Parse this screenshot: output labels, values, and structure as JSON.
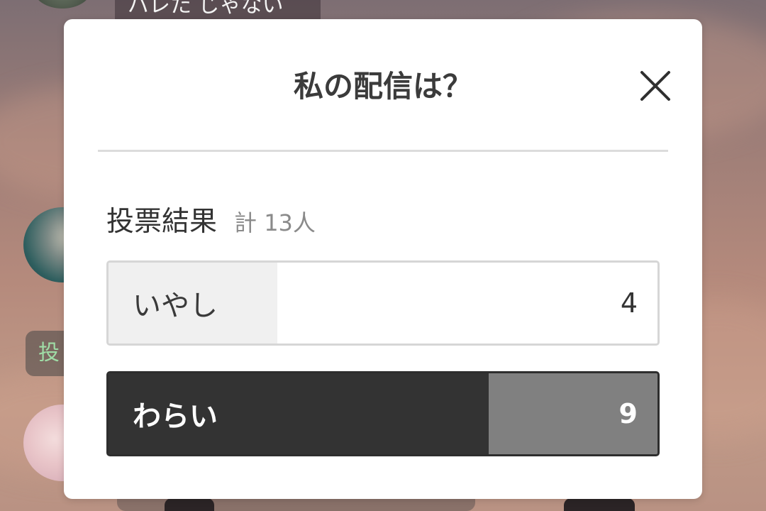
{
  "background": {
    "chat_snippet": "バレた じゃない",
    "poll_chip_text": "投"
  },
  "modal": {
    "title": "私の配信は？",
    "close_icon": "close-icon",
    "result_label": "投票結果",
    "result_total": "計 13人",
    "options": [
      {
        "label": "いやし",
        "count": "4",
        "share": 0.307,
        "selected": false
      },
      {
        "label": "わらい",
        "count": "9",
        "share": 0.692,
        "selected": true
      }
    ]
  },
  "colors": {
    "selected_fill": "#333333",
    "selected_rest": "#808080",
    "unselected_fill": "#f0f0f0",
    "poll_chip_text": "#9fdca6"
  }
}
